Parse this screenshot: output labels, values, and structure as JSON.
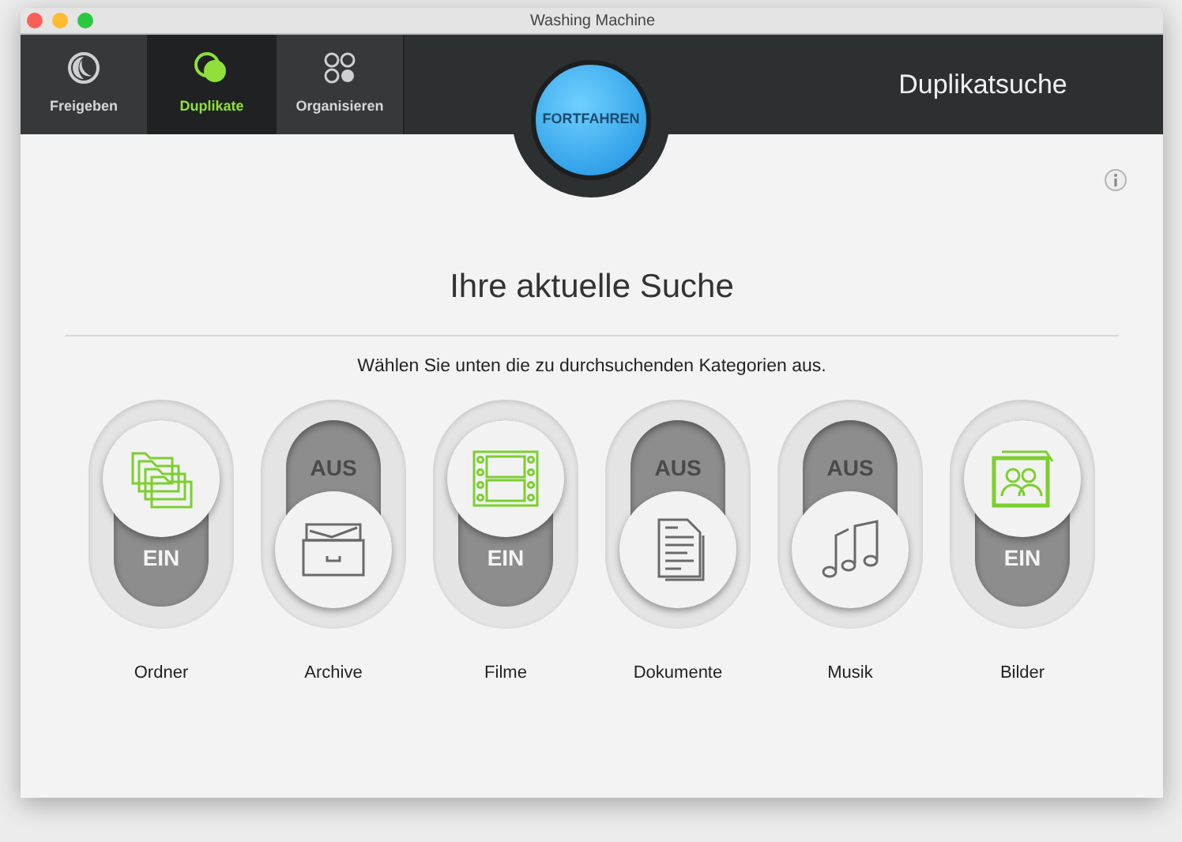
{
  "window": {
    "title": "Washing Machine"
  },
  "tabs": [
    {
      "label": "Freigeben",
      "kind": "moon",
      "selected": false
    },
    {
      "label": "Duplikate",
      "kind": "circles",
      "selected": true
    },
    {
      "label": "Organisieren",
      "kind": "grid",
      "selected": false
    }
  ],
  "start_button": {
    "label": "FORTFAHREN"
  },
  "toolbar_title": "Duplikatsuche",
  "heading": "Ihre aktuelle Suche",
  "subtitle": "Wählen Sie unten die zu durchsuchenden Kategorien aus.",
  "categories": [
    {
      "label": "Ordner",
      "kind": "folders",
      "on": true,
      "state_label": "EIN"
    },
    {
      "label": "Archive",
      "kind": "archive",
      "on": false,
      "state_label": "AUS"
    },
    {
      "label": "Filme",
      "kind": "film",
      "on": true,
      "state_label": "EIN"
    },
    {
      "label": "Dokumente",
      "kind": "document",
      "on": false,
      "state_label": "AUS"
    },
    {
      "label": "Musik",
      "kind": "music",
      "on": false,
      "state_label": "AUS"
    },
    {
      "label": "Bilder",
      "kind": "photos",
      "on": true,
      "state_label": "EIN"
    }
  ]
}
